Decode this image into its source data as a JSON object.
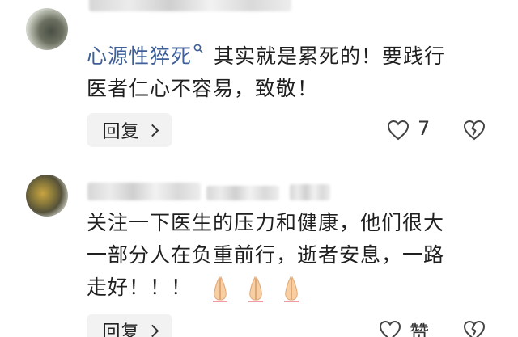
{
  "comments": [
    {
      "topic": "心源性猝死",
      "text_line1": " 其实就是累死的！要践行",
      "text_line2": "医者仁心不容易，致敬！",
      "reply_label": "回复",
      "like_count": "7"
    },
    {
      "text_line1": "关注一下医生的压力和健康，他们很大",
      "text_line2": "一部分人在负重前行，逝者安息，一路",
      "text_line3": "走好！！！",
      "emoji_count": 3,
      "reply_label": "回复",
      "like_label": "赞"
    }
  ],
  "colors": {
    "topic_link": "#3e5f97",
    "text": "#1f1f1f",
    "reply_bg": "#f2f2f2"
  },
  "icons": [
    "search-icon",
    "heart-icon",
    "broken-heart-icon",
    "pray-hands-icon"
  ]
}
